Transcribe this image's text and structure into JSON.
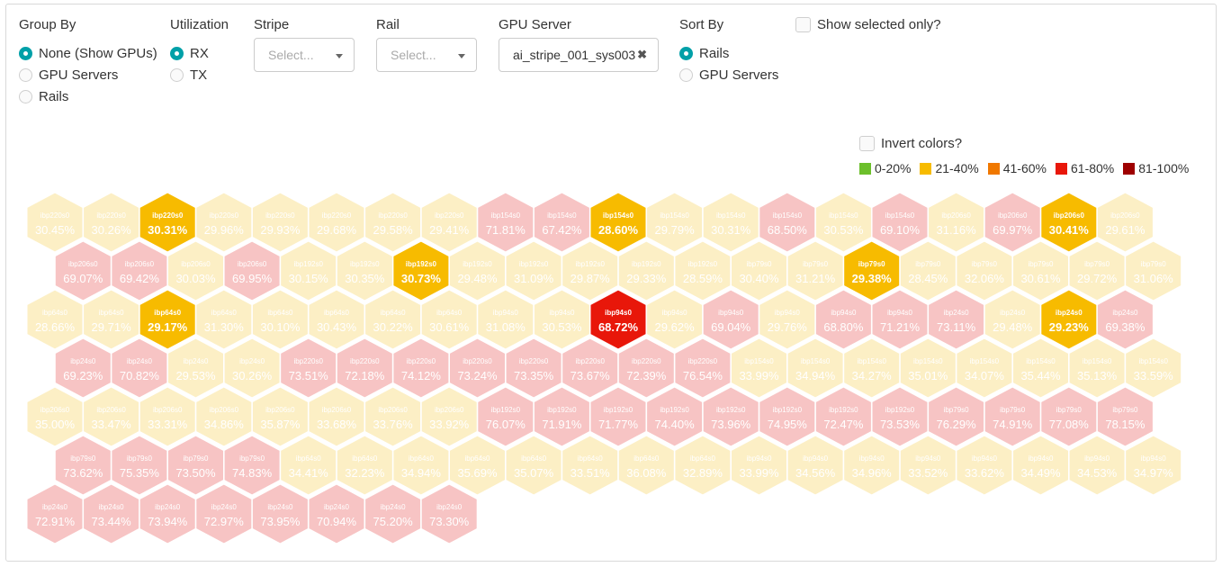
{
  "filters": {
    "group_by": {
      "title": "Group By",
      "options": [
        {
          "label": "None (Show GPUs)",
          "checked": true
        },
        {
          "label": "GPU Servers",
          "checked": false
        },
        {
          "label": "Rails",
          "checked": false
        }
      ]
    },
    "utilization": {
      "title": "Utilization",
      "options": [
        {
          "label": "RX",
          "checked": true
        },
        {
          "label": "TX",
          "checked": false
        }
      ]
    },
    "stripe": {
      "title": "Stripe",
      "placeholder": "Select..."
    },
    "rail": {
      "title": "Rail",
      "placeholder": "Select..."
    },
    "gpu_server": {
      "title": "GPU Server",
      "value": "ai_stripe_001_sys003"
    },
    "sort_by": {
      "title": "Sort By",
      "options": [
        {
          "label": "Rails",
          "checked": true
        },
        {
          "label": "GPU Servers",
          "checked": false
        }
      ]
    },
    "show_selected_only": {
      "label": "Show selected only?",
      "checked": false
    }
  },
  "invert_colors": {
    "label": "Invert colors?",
    "checked": false
  },
  "legend": [
    {
      "label": "0-20%",
      "color": "#6cbf2b"
    },
    {
      "label": "21-40%",
      "color": "#f7bb00"
    },
    {
      "label": "41-60%",
      "color": "#f07800"
    },
    {
      "label": "61-80%",
      "color": "#e8170a"
    },
    {
      "label": "81-100%",
      "color": "#9e0000"
    }
  ],
  "highlight_colors": {
    "21-40%": "#f7bb00",
    "61-80%": "#e8170a"
  },
  "faded_colors": {
    "21-40%": "#fcefc5",
    "61-80%": "#f7c4c4"
  },
  "hex_rows": [
    [
      {
        "label": "ibp220s0",
        "value": "30.45%"
      },
      {
        "label": "ibp220s0",
        "value": "30.26%"
      },
      {
        "label": "ibp220s0",
        "value": "30.31%",
        "highlight": true
      },
      {
        "label": "ibp220s0",
        "value": "29.96%"
      },
      {
        "label": "ibp220s0",
        "value": "29.93%"
      },
      {
        "label": "ibp220s0",
        "value": "29.68%"
      },
      {
        "label": "ibp220s0",
        "value": "29.58%"
      },
      {
        "label": "ibp220s0",
        "value": "29.41%"
      },
      {
        "label": "ibp154s0",
        "value": "71.81%"
      },
      {
        "label": "ibp154s0",
        "value": "67.42%"
      },
      {
        "label": "ibp154s0",
        "value": "28.60%",
        "highlight": true
      },
      {
        "label": "ibp154s0",
        "value": "29.79%"
      },
      {
        "label": "ibp154s0",
        "value": "30.31%"
      },
      {
        "label": "ibp154s0",
        "value": "68.50%"
      },
      {
        "label": "ibp154s0",
        "value": "30.53%"
      },
      {
        "label": "ibp154s0",
        "value": "69.10%"
      },
      {
        "label": "ibp206s0",
        "value": "31.16%"
      },
      {
        "label": "ibp206s0",
        "value": "69.97%"
      },
      {
        "label": "ibp206s0",
        "value": "30.41%",
        "highlight": true
      },
      {
        "label": "ibp206s0",
        "value": "29.61%"
      }
    ],
    [
      {
        "label": "ibp206s0",
        "value": "69.07%"
      },
      {
        "label": "ibp206s0",
        "value": "69.42%"
      },
      {
        "label": "ibp206s0",
        "value": "30.03%"
      },
      {
        "label": "ibp206s0",
        "value": "69.95%"
      },
      {
        "label": "ibp192s0",
        "value": "30.15%"
      },
      {
        "label": "ibp192s0",
        "value": "30.35%"
      },
      {
        "label": "ibp192s0",
        "value": "30.73%",
        "highlight": true
      },
      {
        "label": "ibp192s0",
        "value": "29.48%"
      },
      {
        "label": "ibp192s0",
        "value": "31.09%"
      },
      {
        "label": "ibp192s0",
        "value": "29.87%"
      },
      {
        "label": "ibp192s0",
        "value": "29.33%"
      },
      {
        "label": "ibp192s0",
        "value": "28.59%"
      },
      {
        "label": "ibp79s0",
        "value": "30.40%"
      },
      {
        "label": "ibp79s0",
        "value": "31.21%"
      },
      {
        "label": "ibp79s0",
        "value": "29.38%",
        "highlight": true
      },
      {
        "label": "ibp79s0",
        "value": "28.45%"
      },
      {
        "label": "ibp79s0",
        "value": "32.06%"
      },
      {
        "label": "ibp79s0",
        "value": "30.61%"
      },
      {
        "label": "ibp79s0",
        "value": "29.72%"
      },
      {
        "label": "ibp79s0",
        "value": "31.06%"
      }
    ],
    [
      {
        "label": "ibp64s0",
        "value": "28.66%"
      },
      {
        "label": "ibp64s0",
        "value": "29.71%"
      },
      {
        "label": "ibp64s0",
        "value": "29.17%",
        "highlight": true
      },
      {
        "label": "ibp64s0",
        "value": "31.30%"
      },
      {
        "label": "ibp64s0",
        "value": "30.10%"
      },
      {
        "label": "ibp64s0",
        "value": "30.43%"
      },
      {
        "label": "ibp64s0",
        "value": "30.22%"
      },
      {
        "label": "ibp64s0",
        "value": "30.61%"
      },
      {
        "label": "ibp94s0",
        "value": "31.08%"
      },
      {
        "label": "ibp94s0",
        "value": "30.53%"
      },
      {
        "label": "ibp94s0",
        "value": "68.72%",
        "highlight": true
      },
      {
        "label": "ibp94s0",
        "value": "29.62%"
      },
      {
        "label": "ibp94s0",
        "value": "69.04%"
      },
      {
        "label": "ibp94s0",
        "value": "29.76%"
      },
      {
        "label": "ibp94s0",
        "value": "68.80%"
      },
      {
        "label": "ibp94s0",
        "value": "71.21%"
      },
      {
        "label": "ibp24s0",
        "value": "73.11%"
      },
      {
        "label": "ibp24s0",
        "value": "29.48%"
      },
      {
        "label": "ibp24s0",
        "value": "29.23%",
        "highlight": true
      },
      {
        "label": "ibp24s0",
        "value": "69.38%"
      }
    ],
    [
      {
        "label": "ibp24s0",
        "value": "69.23%"
      },
      {
        "label": "ibp24s0",
        "value": "70.82%"
      },
      {
        "label": "ibp24s0",
        "value": "29.53%"
      },
      {
        "label": "ibp24s0",
        "value": "30.26%"
      },
      {
        "label": "ibp220s0",
        "value": "73.51%"
      },
      {
        "label": "ibp220s0",
        "value": "72.18%"
      },
      {
        "label": "ibp220s0",
        "value": "74.12%"
      },
      {
        "label": "ibp220s0",
        "value": "73.24%"
      },
      {
        "label": "ibp220s0",
        "value": "73.35%"
      },
      {
        "label": "ibp220s0",
        "value": "73.67%"
      },
      {
        "label": "ibp220s0",
        "value": "72.39%"
      },
      {
        "label": "ibp220s0",
        "value": "76.54%"
      },
      {
        "label": "ibp154s0",
        "value": "33.99%"
      },
      {
        "label": "ibp154s0",
        "value": "34.94%"
      },
      {
        "label": "ibp154s0",
        "value": "34.27%"
      },
      {
        "label": "ibp154s0",
        "value": "35.01%"
      },
      {
        "label": "ibp154s0",
        "value": "34.07%"
      },
      {
        "label": "ibp154s0",
        "value": "35.44%"
      },
      {
        "label": "ibp154s0",
        "value": "35.13%"
      },
      {
        "label": "ibp154s0",
        "value": "33.59%"
      }
    ],
    [
      {
        "label": "ibp206s0",
        "value": "35.00%"
      },
      {
        "label": "ibp206s0",
        "value": "33.47%"
      },
      {
        "label": "ibp206s0",
        "value": "33.31%"
      },
      {
        "label": "ibp206s0",
        "value": "34.86%"
      },
      {
        "label": "ibp206s0",
        "value": "35.87%"
      },
      {
        "label": "ibp206s0",
        "value": "33.68%"
      },
      {
        "label": "ibp206s0",
        "value": "33.76%"
      },
      {
        "label": "ibp206s0",
        "value": "33.92%"
      },
      {
        "label": "ibp192s0",
        "value": "76.07%"
      },
      {
        "label": "ibp192s0",
        "value": "71.91%"
      },
      {
        "label": "ibp192s0",
        "value": "71.77%"
      },
      {
        "label": "ibp192s0",
        "value": "74.40%"
      },
      {
        "label": "ibp192s0",
        "value": "73.96%"
      },
      {
        "label": "ibp192s0",
        "value": "74.95%"
      },
      {
        "label": "ibp192s0",
        "value": "72.47%"
      },
      {
        "label": "ibp192s0",
        "value": "73.53%"
      },
      {
        "label": "ibp79s0",
        "value": "76.29%"
      },
      {
        "label": "ibp79s0",
        "value": "74.91%"
      },
      {
        "label": "ibp79s0",
        "value": "77.08%"
      },
      {
        "label": "ibp79s0",
        "value": "78.15%"
      }
    ],
    [
      {
        "label": "ibp79s0",
        "value": "73.62%"
      },
      {
        "label": "ibp79s0",
        "value": "75.35%"
      },
      {
        "label": "ibp79s0",
        "value": "73.50%"
      },
      {
        "label": "ibp79s0",
        "value": "74.83%"
      },
      {
        "label": "ibp64s0",
        "value": "34.41%"
      },
      {
        "label": "ibp64s0",
        "value": "32.23%"
      },
      {
        "label": "ibp64s0",
        "value": "34.94%"
      },
      {
        "label": "ibp64s0",
        "value": "35.69%"
      },
      {
        "label": "ibp64s0",
        "value": "35.07%"
      },
      {
        "label": "ibp64s0",
        "value": "33.51%"
      },
      {
        "label": "ibp64s0",
        "value": "36.08%"
      },
      {
        "label": "ibp64s0",
        "value": "32.89%"
      },
      {
        "label": "ibp94s0",
        "value": "33.99%"
      },
      {
        "label": "ibp94s0",
        "value": "34.56%"
      },
      {
        "label": "ibp94s0",
        "value": "34.96%"
      },
      {
        "label": "ibp94s0",
        "value": "33.52%"
      },
      {
        "label": "ibp94s0",
        "value": "33.62%"
      },
      {
        "label": "ibp94s0",
        "value": "34.49%"
      },
      {
        "label": "ibp94s0",
        "value": "34.53%"
      },
      {
        "label": "ibp94s0",
        "value": "34.97%"
      }
    ],
    [
      {
        "label": "ibp24s0",
        "value": "72.91%"
      },
      {
        "label": "ibp24s0",
        "value": "73.44%"
      },
      {
        "label": "ibp24s0",
        "value": "73.94%"
      },
      {
        "label": "ibp24s0",
        "value": "72.97%"
      },
      {
        "label": "ibp24s0",
        "value": "73.95%"
      },
      {
        "label": "ibp24s0",
        "value": "70.94%"
      },
      {
        "label": "ibp24s0",
        "value": "75.20%"
      },
      {
        "label": "ibp24s0",
        "value": "73.30%"
      }
    ]
  ]
}
